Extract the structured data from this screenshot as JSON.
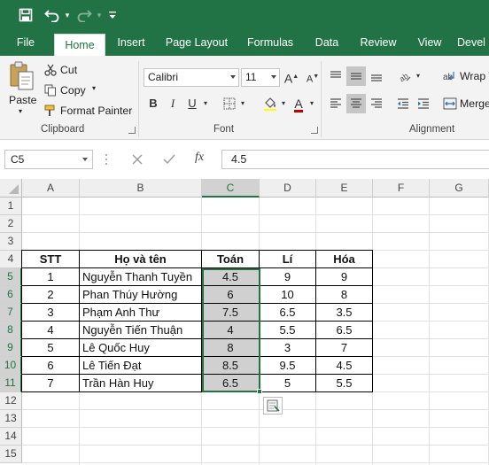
{
  "qat": {
    "save_icon": "save-icon",
    "undo_icon": "undo-icon",
    "redo_icon": "redo-icon",
    "customize_icon": "customize-qat-icon"
  },
  "tabs": [
    {
      "label": "File",
      "active": false
    },
    {
      "label": "Home",
      "active": true
    },
    {
      "label": "Insert",
      "active": false
    },
    {
      "label": "Page Layout",
      "active": false
    },
    {
      "label": "Formulas",
      "active": false
    },
    {
      "label": "Data",
      "active": false
    },
    {
      "label": "Review",
      "active": false
    },
    {
      "label": "View",
      "active": false
    },
    {
      "label": "Devel",
      "active": false
    }
  ],
  "ribbon": {
    "clipboard": {
      "paste": "Paste",
      "cut": "Cut",
      "copy": "Copy",
      "format_painter": "Format Painter",
      "group": "Clipboard"
    },
    "font": {
      "name": "Calibri",
      "size": "11",
      "bold": "B",
      "italic": "I",
      "underline": "U",
      "group": "Font",
      "grow": "A",
      "shrink": "A",
      "font_color": "A"
    },
    "alignment": {
      "wrap": "Wrap T",
      "merge": "Merge",
      "group": "Alignment"
    }
  },
  "formula_bar": {
    "name_box": "C5",
    "fx": "fx",
    "value": "4.5"
  },
  "columns": [
    "A",
    "B",
    "C",
    "D",
    "E",
    "F",
    "G"
  ],
  "selected_column": "C",
  "rows": [
    "1",
    "2",
    "3",
    "4",
    "5",
    "6",
    "7",
    "8",
    "9",
    "10",
    "11",
    "12",
    "13",
    "14",
    "15"
  ],
  "selected_rows": [
    "5",
    "6",
    "7",
    "8",
    "9",
    "10",
    "11"
  ],
  "table": {
    "headers": [
      "STT",
      "Họ và tên",
      "Toán",
      "Lí",
      "Hóa"
    ],
    "rows": [
      [
        "1",
        "Nguyễn Thanh Tuyền",
        "4.5",
        "9",
        "9"
      ],
      [
        "2",
        "Phan Thúy Hường",
        "6",
        "10",
        "8"
      ],
      [
        "3",
        "Phạm Anh Thư",
        "7.5",
        "6.5",
        "3.5"
      ],
      [
        "4",
        "Nguyễn Tiến Thuận",
        "4",
        "5.5",
        "6.5"
      ],
      [
        "5",
        "Lê Quốc Huy",
        "8",
        "3",
        "7"
      ],
      [
        "6",
        "Lê Tiến Đạt",
        "8.5",
        "9.5",
        "4.5"
      ],
      [
        "7",
        "Trần Hàn Huy",
        "6.5",
        "5",
        "5.5"
      ]
    ]
  },
  "colors": {
    "excel_green": "#217346",
    "selection_shade": "#d0d0d0"
  }
}
